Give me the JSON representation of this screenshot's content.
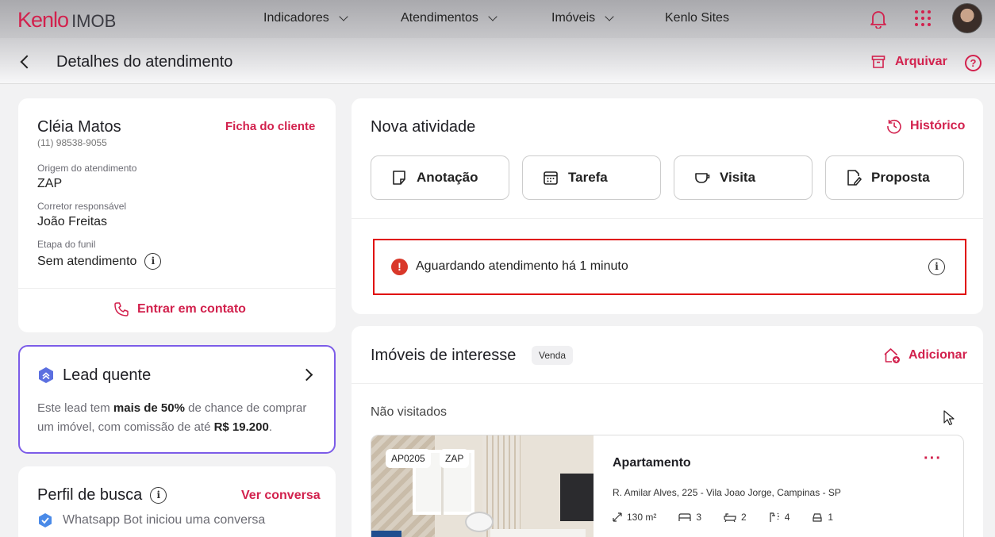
{
  "brand": {
    "name": "Kenlo",
    "product": "IMOB",
    "accent_color": "#d2214d"
  },
  "nav": {
    "items": [
      {
        "label": "Indicadores",
        "dropdown": true
      },
      {
        "label": "Atendimentos",
        "dropdown": true
      },
      {
        "label": "Imóveis",
        "dropdown": true
      },
      {
        "label": "Kenlo Sites",
        "dropdown": false
      }
    ],
    "icons": [
      "bell-icon",
      "apps-grid-icon",
      "user-avatar"
    ]
  },
  "header": {
    "title": "Detalhes do atendimento",
    "archive_label": "Arquivar",
    "help_symbol": "?"
  },
  "client": {
    "name": "Cléia Matos",
    "phone": "(11) 98538-9055",
    "profile_link": "Ficha do cliente",
    "origin_label": "Origem do atendimento",
    "origin_value": "ZAP",
    "agent_label": "Corretor responsável",
    "agent_value": "João Freitas",
    "stage_label": "Etapa do funil",
    "stage_value": "Sem atendimento",
    "contact_label": "Entrar em contato"
  },
  "lead": {
    "title": "Lead quente",
    "text_1": "Este lead tem ",
    "bold_1": "mais de 50%",
    "text_2": " de chance de comprar um imóvel, com comissão de até ",
    "bold_2": "R$ 19.200",
    "text_3": "."
  },
  "search_profile": {
    "title": "Perfil de busca",
    "link": "Ver conversa",
    "item": "Whatsapp Bot iniciou uma conversa"
  },
  "activity": {
    "title": "Nova atividade",
    "history_label": "Histórico",
    "buttons": [
      {
        "label": "Anotação",
        "icon": "note-icon"
      },
      {
        "label": "Tarefa",
        "icon": "calendar-icon"
      },
      {
        "label": "Visita",
        "icon": "visit-icon"
      },
      {
        "label": "Proposta",
        "icon": "proposal-icon"
      }
    ],
    "alert_text": "Aguardando atendimento há 1 minuto",
    "alert_color": "#d9382a"
  },
  "properties": {
    "title": "Imóveis de interesse",
    "badge": "Venda",
    "add_label": "Adicionar",
    "section": "Não visitados",
    "listing": {
      "code": "AP0205",
      "source": "ZAP",
      "type": "Apartamento",
      "address": "R. Amilar Alves, 225 - Vila Joao Jorge, Campinas - SP",
      "area": "130 m²",
      "bedrooms": "3",
      "bathrooms": "2",
      "suites": "4",
      "parking": "1"
    }
  }
}
